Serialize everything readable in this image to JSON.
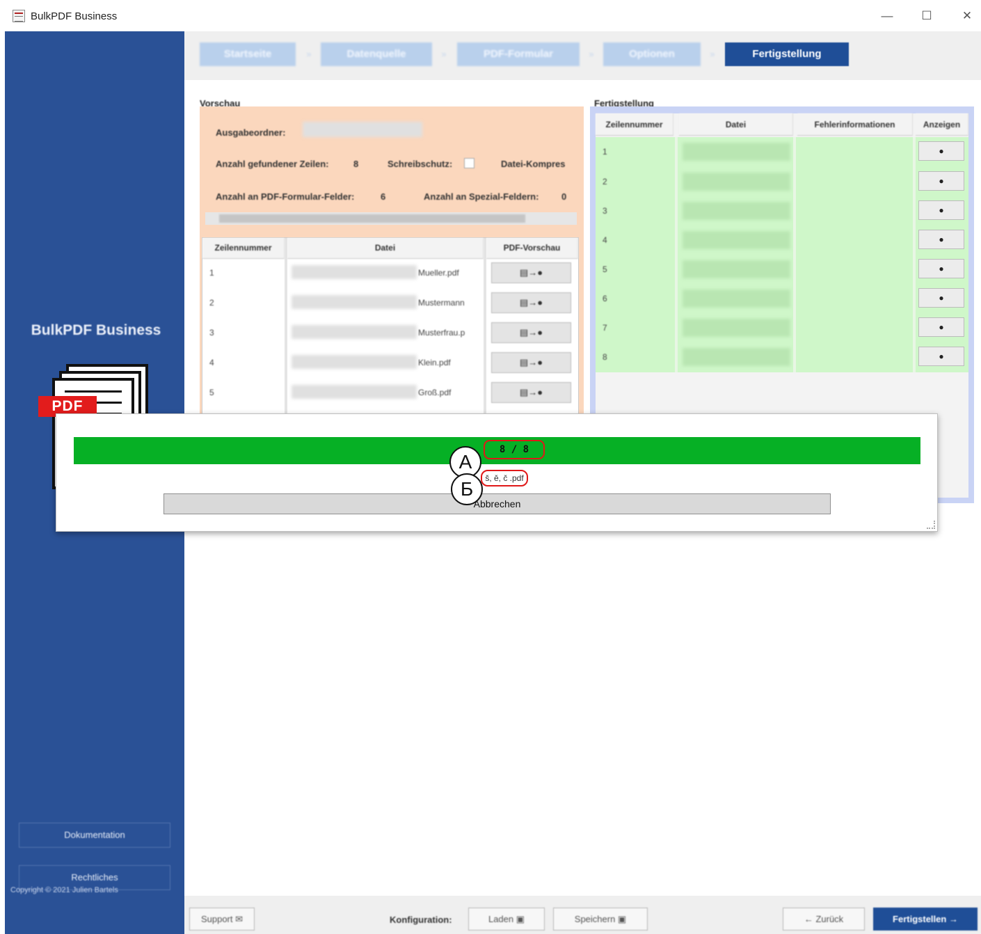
{
  "window": {
    "title": "BulkPDF Business",
    "minimize": "—",
    "maximize": "☐",
    "close": "✕"
  },
  "sidebar": {
    "brand": "BulkPDF Business",
    "logo_text": "PDF",
    "doc_button": "Dokumentation",
    "legal_button": "Rechtliches",
    "copyright": "Copyright © 2021 Julien Bartels"
  },
  "steps": [
    {
      "label": "Startseite",
      "active": false
    },
    {
      "label": "Datenquelle",
      "active": false
    },
    {
      "label": "PDF-Formular",
      "active": false
    },
    {
      "label": "Optionen",
      "active": false
    },
    {
      "label": "Fertigstellung",
      "active": true
    }
  ],
  "vorschau": {
    "title": "Vorschau",
    "ausgabeordner_label": "Ausgabeordner:",
    "zeilen_label": "Anzahl gefundener Zeilen:",
    "zeilen_value": "8",
    "schreibschutz_label": "Schreibschutz:",
    "kompression_label": "Datei-Kompres",
    "formfields_label": "Anzahl an PDF-Formular-Felder:",
    "formfields_value": "6",
    "specialfields_label": "Anzahl an Spezial-Feldern:",
    "specialfields_value": "0",
    "columns": [
      "Zeilennummer",
      "Datei",
      "PDF-Vorschau"
    ],
    "rows": [
      {
        "num": "1",
        "file": "Mueller.pdf"
      },
      {
        "num": "2",
        "file": "Mustermann"
      },
      {
        "num": "3",
        "file": "Musterfrau.p"
      },
      {
        "num": "4",
        "file": "Klein.pdf"
      },
      {
        "num": "5",
        "file": "Groß.pdf"
      }
    ],
    "preview_button": "▤→●"
  },
  "fertigstellung": {
    "title": "Fertigstellung",
    "columns": [
      "Zeilennummer",
      "Datei",
      "Fehlerinformationen",
      "Anzeigen"
    ],
    "rows": [
      "1",
      "2",
      "3",
      "4",
      "5",
      "6",
      "7",
      "8"
    ],
    "view_button": "●"
  },
  "footer": {
    "support": "Support ✉",
    "config_label": "Konfiguration:",
    "load": "Laden ▣",
    "save": "Speichern ▣",
    "back": "← Zurück",
    "finish": "Fertigstellen →"
  },
  "dialog": {
    "progress_text": "8 / 8",
    "progress_fraction": 1.0,
    "current_file": "š, ě, č .pdf",
    "cancel": "Abbrechen",
    "marker_a": "А",
    "marker_b": "Б"
  },
  "colors": {
    "sidebar": "#2a5196",
    "progress": "#06b025",
    "highlight": "#e01818",
    "active_step": "#1f4e97"
  }
}
